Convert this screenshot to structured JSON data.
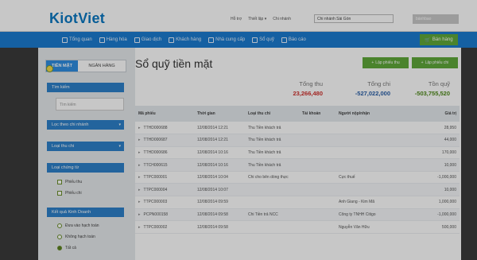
{
  "header": {
    "logo": "KiotViet",
    "links": [
      "Hỗ trợ",
      "Thiết lập ▾",
      "Chi nhánh"
    ],
    "branch": "Chi nhánh Sài Gòn",
    "user": "bánhbao"
  },
  "nav": {
    "items": [
      "Tổng quan",
      "Hàng hóa",
      "Giao dịch",
      "Khách hàng",
      "Nhà cung cấp",
      "Sổ quỹ",
      "Báo cáo"
    ],
    "sell_button": "Bán hàng"
  },
  "sidebar": {
    "tabs": [
      "TIỀN MẶT",
      "NGÂN HÀNG"
    ],
    "search_head": "Tìm kiếm",
    "search_placeholder": "Tìm kiếm",
    "branch_filter": "Lọc theo chi nhánh",
    "type_filter": "Loại thu chi",
    "voucher_head": "Loại chứng từ",
    "voucher_options": [
      "Phiếu thu",
      "Phiếu chi"
    ],
    "result_head": "Kết quả Kinh Doanh",
    "result_options": [
      "Đưa vào hạch toán",
      "Không hạch toán",
      "Tất cả"
    ]
  },
  "page": {
    "title": "Sổ quỹ tiền mặt",
    "btn_receipt": "Lập phiếu thu",
    "btn_payment": "Lập phiếu chi"
  },
  "summary": {
    "labels": [
      "Tổng thu",
      "Tổng chi",
      "Tồn quỹ"
    ],
    "values": [
      "23,266,480",
      "-527,022,000",
      "-503,755,520"
    ],
    "colors": [
      "#d0312d",
      "#2a5fa8",
      "#4f8a1a"
    ]
  },
  "table": {
    "headers": [
      "Mã phiếu",
      "Thời gian",
      "Loại thu chi",
      "Tài khoản",
      "Người nộp/nhận",
      "Giá trị"
    ],
    "rows": [
      [
        "TTHD000688",
        "12/08/2014 12:21",
        "Thu Tiền khách trả",
        "",
        "",
        "28,950"
      ],
      [
        "TTHD000687",
        "12/08/2014 12:21",
        "Thu Tiền khách trả",
        "",
        "",
        "44,000"
      ],
      [
        "TTHD000686",
        "12/08/2014 10:16",
        "Thu Tiền khách trả",
        "",
        "",
        "170,000"
      ],
      [
        "TTCH000615",
        "12/08/2014 10:16",
        "Thu Tiền khách trả",
        "",
        "",
        "10,000"
      ],
      [
        "TTPC000001",
        "12/08/2014 10:04",
        "Chi cho bên dòng thực",
        "",
        "Cực thuế",
        "-1,000,000"
      ],
      [
        "TTPC000004",
        "12/08/2014 10:07",
        "",
        "",
        "",
        "10,000"
      ],
      [
        "TTPC000003",
        "12/08/2014 09:59",
        "",
        "",
        "Anh Giang - Kim Mã",
        "1,000,000"
      ],
      [
        "PCPN000158",
        "12/08/2014 09:58",
        "Chi Tiền trả NCC",
        "",
        "Công ty TNHH Citigo",
        "-1,000,000"
      ],
      [
        "TTPC000002",
        "12/08/2014 09:58",
        "",
        "",
        "Nguyễn Văn Hữu",
        "500,000"
      ]
    ]
  }
}
